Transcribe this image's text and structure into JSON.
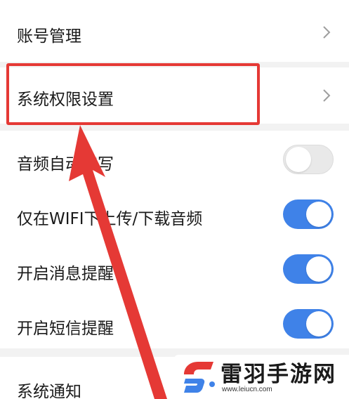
{
  "settings": {
    "account_management": "账号管理",
    "system_permissions": "系统权限设置",
    "audio_auto_transcribe": "音频自动转写",
    "wifi_only_transfer": "仅在WIFI下上传/下载音频",
    "message_reminder": "开启消息提醒",
    "sms_reminder": "开启短信提醒",
    "system_notification": "系统通知"
  },
  "toggles": {
    "audio_auto_transcribe": false,
    "wifi_only_transfer": true,
    "message_reminder": true,
    "sms_reminder": true
  },
  "watermark": {
    "title": "雷羽手游网",
    "url": "www.leiucn.com"
  },
  "colors": {
    "toggle_on": "#3f82e8",
    "highlight": "#e53935",
    "logo_red": "#e53935",
    "logo_blue": "#3f82e8"
  }
}
